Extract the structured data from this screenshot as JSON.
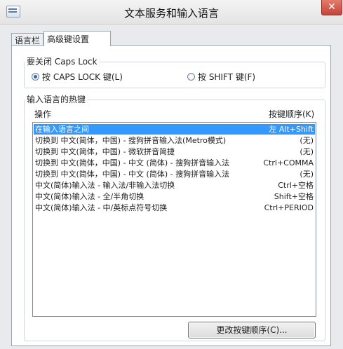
{
  "window": {
    "title": "文本服务和输入语言",
    "close_label": "✕"
  },
  "tabs": [
    {
      "label": "语言栏",
      "active": false
    },
    {
      "label": "高级键设置",
      "active": true
    }
  ],
  "caps_lock": {
    "group_label": "要关闭 Caps Lock",
    "options": [
      {
        "label": "按 CAPS LOCK 键(L)",
        "checked": true
      },
      {
        "label": "按 SHIFT 键(F)",
        "checked": false
      }
    ]
  },
  "hotkeys": {
    "group_label": "输入语言的热键",
    "col_action": "操作",
    "col_sequence": "按键顺序(K)",
    "rows": [
      {
        "action": "在输入语言之间",
        "keys": "左 Alt+Shift",
        "selected": true
      },
      {
        "action": "切换到 中文(简体，中国) - 搜狗拼音输入法(Metro模式)",
        "keys": "(无)",
        "selected": false
      },
      {
        "action": "切换到 中文(简体，中国) - 微软拼音简捷",
        "keys": "(无)",
        "selected": false
      },
      {
        "action": "切换到 中文(简体，中国) - 中文 (简体) - 搜狗拼音输入法",
        "keys": "Ctrl+COMMA",
        "selected": false
      },
      {
        "action": "切换到 中文(简体，中国) - 中文 (简体) - 搜狗拼音输入法",
        "keys": "(无)",
        "selected": false
      },
      {
        "action": "中文(简体)输入法 - 输入法/非输入法切换",
        "keys": "Ctrl+空格",
        "selected": false
      },
      {
        "action": "中文(简体)输入法 - 全/半角切换",
        "keys": "Shift+空格",
        "selected": false
      },
      {
        "action": "中文(简体)输入法 - 中/英标点符号切换",
        "keys": "Ctrl+PERIOD",
        "selected": false
      }
    ],
    "change_button": "更改按键顺序(C)..."
  },
  "colors": {
    "selection": "#3399ff",
    "close_button": "#c5443a"
  }
}
